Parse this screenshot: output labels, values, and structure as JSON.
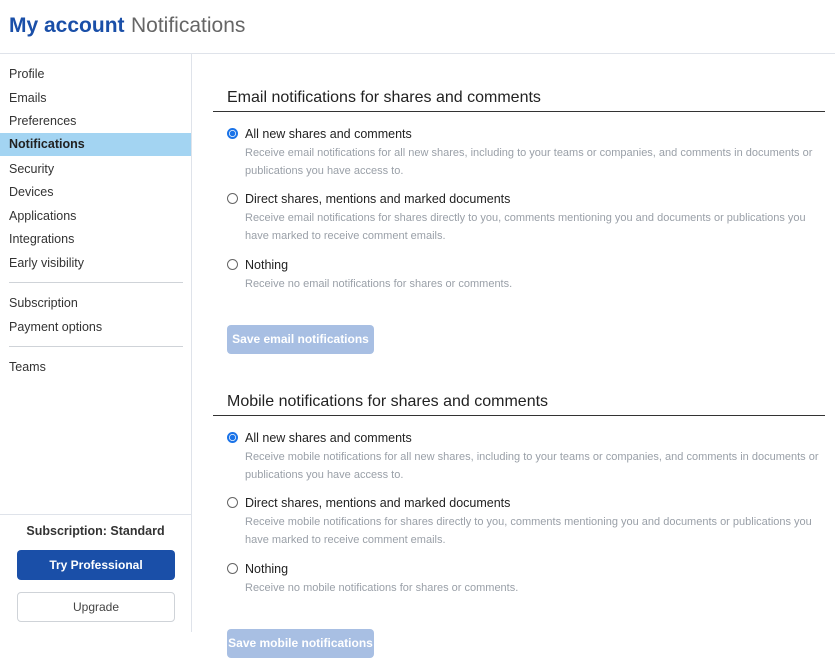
{
  "header": {
    "title": "My account",
    "subtitle": "Notifications"
  },
  "sidebar": {
    "items": [
      {
        "label": "Profile"
      },
      {
        "label": "Emails"
      },
      {
        "label": "Preferences"
      },
      {
        "label": "Notifications",
        "active": true
      },
      {
        "label": "Security"
      },
      {
        "label": "Devices"
      },
      {
        "label": "Applications"
      },
      {
        "label": "Integrations"
      },
      {
        "label": "Early visibility"
      },
      {
        "label": "Subscription"
      },
      {
        "label": "Payment options"
      },
      {
        "label": "Teams"
      }
    ],
    "footer": {
      "subscription_label": "Subscription: Standard",
      "try_professional": "Try Professional",
      "upgrade": "Upgrade"
    }
  },
  "email_section": {
    "title": "Email notifications for shares and comments",
    "options": [
      {
        "label": "All new shares and comments",
        "description": "Receive email notifications for all new shares, including to your teams or companies, and comments in documents or publications you have access to.",
        "checked": true
      },
      {
        "label": "Direct shares, mentions and marked documents",
        "description": "Receive email notifications for shares directly to you, comments mentioning you and documents or publications you have marked to receive comment emails.",
        "checked": false
      },
      {
        "label": "Nothing",
        "description": "Receive no email notifications for shares or comments.",
        "checked": false
      }
    ],
    "save_label": "Save email notifications"
  },
  "mobile_section": {
    "title": "Mobile notifications for shares and comments",
    "options": [
      {
        "label": "All new shares and comments",
        "description": "Receive mobile notifications for all new shares, including to your teams or companies, and comments in documents or publications you have access to.",
        "checked": true
      },
      {
        "label": "Direct shares, mentions and marked documents",
        "description": "Receive mobile notifications for shares directly to you, comments mentioning you and documents or publications you have marked to receive comment emails.",
        "checked": false
      },
      {
        "label": "Nothing",
        "description": "Receive no mobile notifications for shares or comments.",
        "checked": false
      }
    ],
    "save_label": "Save mobile notifications"
  },
  "colors": {
    "brand": "#1a4fa8",
    "active_nav": "#a3d4f2",
    "radio_checked": "#1a73e8",
    "disabled_button": "#a8bfe3"
  }
}
